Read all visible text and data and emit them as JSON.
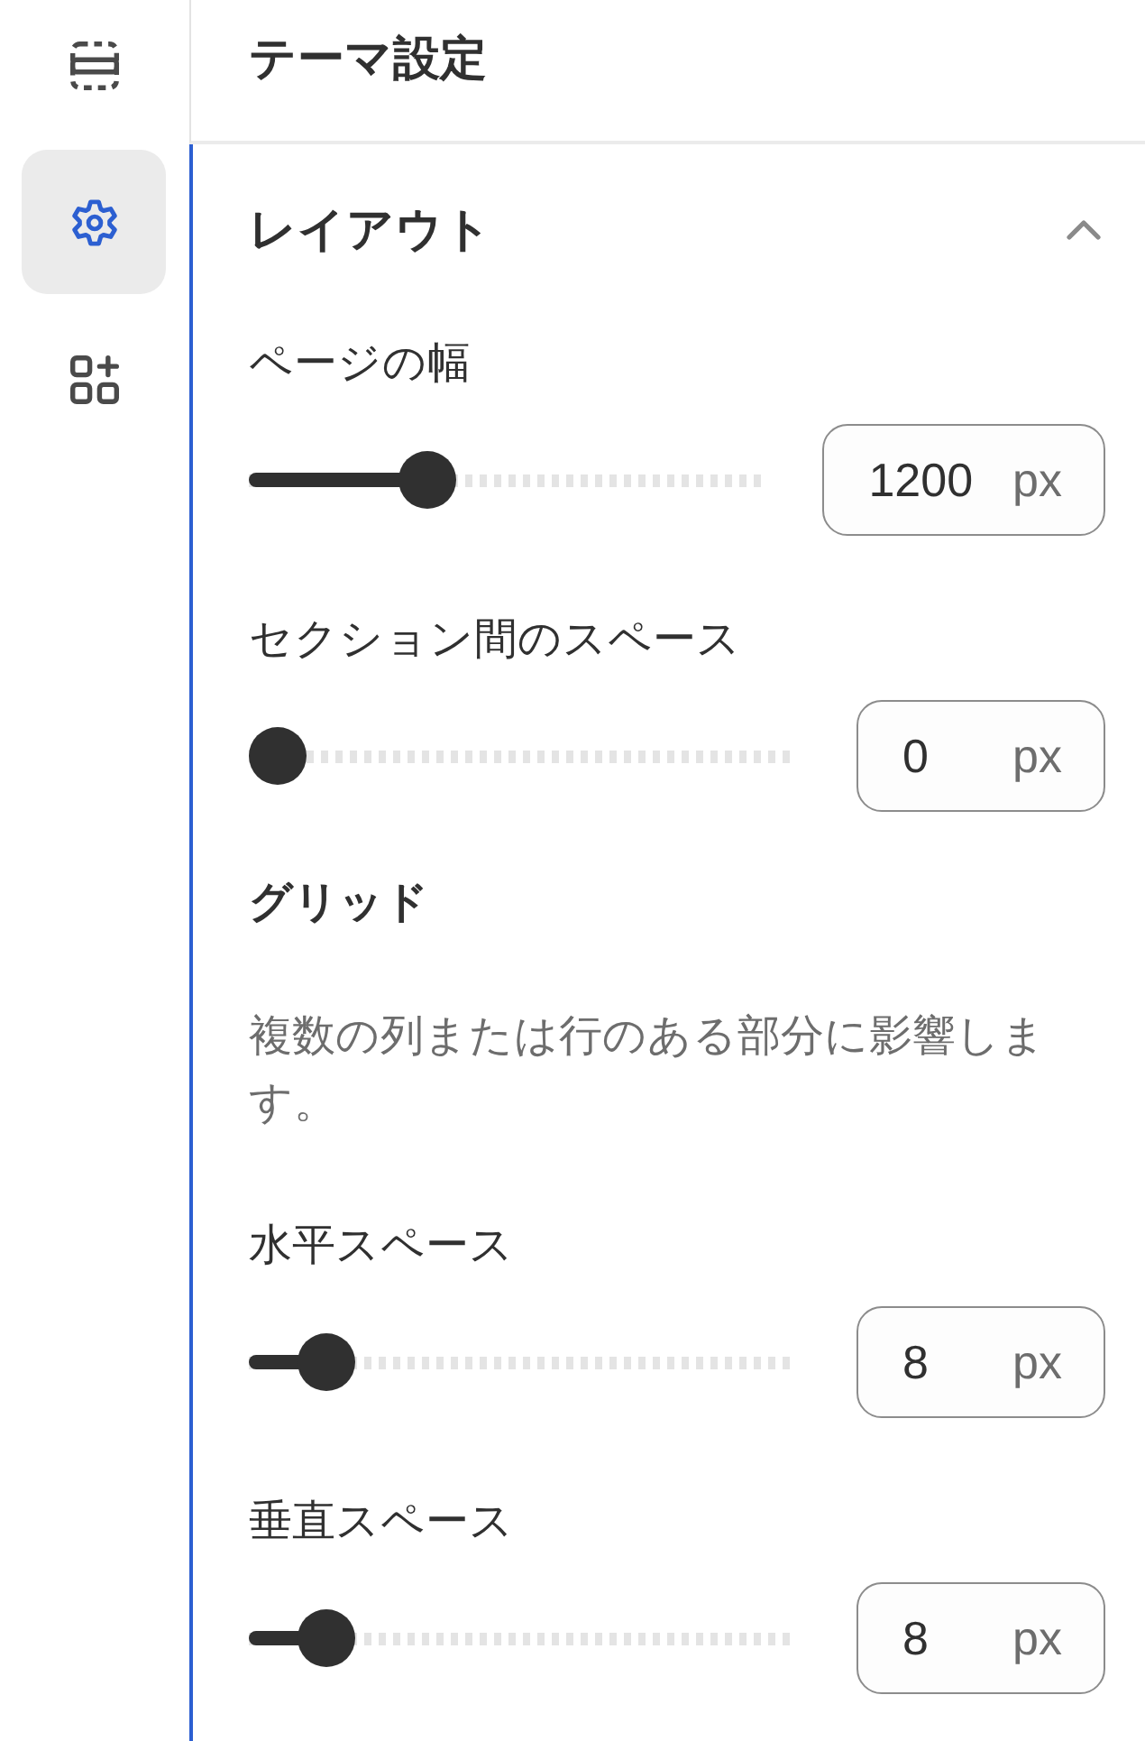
{
  "sidebar": {
    "items": [
      {
        "kind": "sections",
        "selected": false
      },
      {
        "kind": "settings",
        "selected": true
      },
      {
        "kind": "apps",
        "selected": false
      }
    ]
  },
  "header": {
    "title": "テーマ設定"
  },
  "section": {
    "title": "レイアウト",
    "expanded": true,
    "items": [
      {
        "kind": "slider",
        "label": "ページの幅",
        "level": 0.33,
        "value": "1200",
        "unit": "px"
      },
      {
        "kind": "slider",
        "label": "セクション間のスペース",
        "level": 0,
        "value": "0",
        "unit": "px"
      },
      {
        "kind": "heading",
        "text": "グリッド"
      },
      {
        "kind": "note",
        "text": "複数の列または行のある部分に影響します。"
      },
      {
        "kind": "slider",
        "label": "水平スペース",
        "level": 0.1,
        "value": "8",
        "unit": "px"
      },
      {
        "kind": "slider",
        "label": "垂直スペース",
        "level": 0.1,
        "value": "8",
        "unit": "px"
      }
    ]
  }
}
